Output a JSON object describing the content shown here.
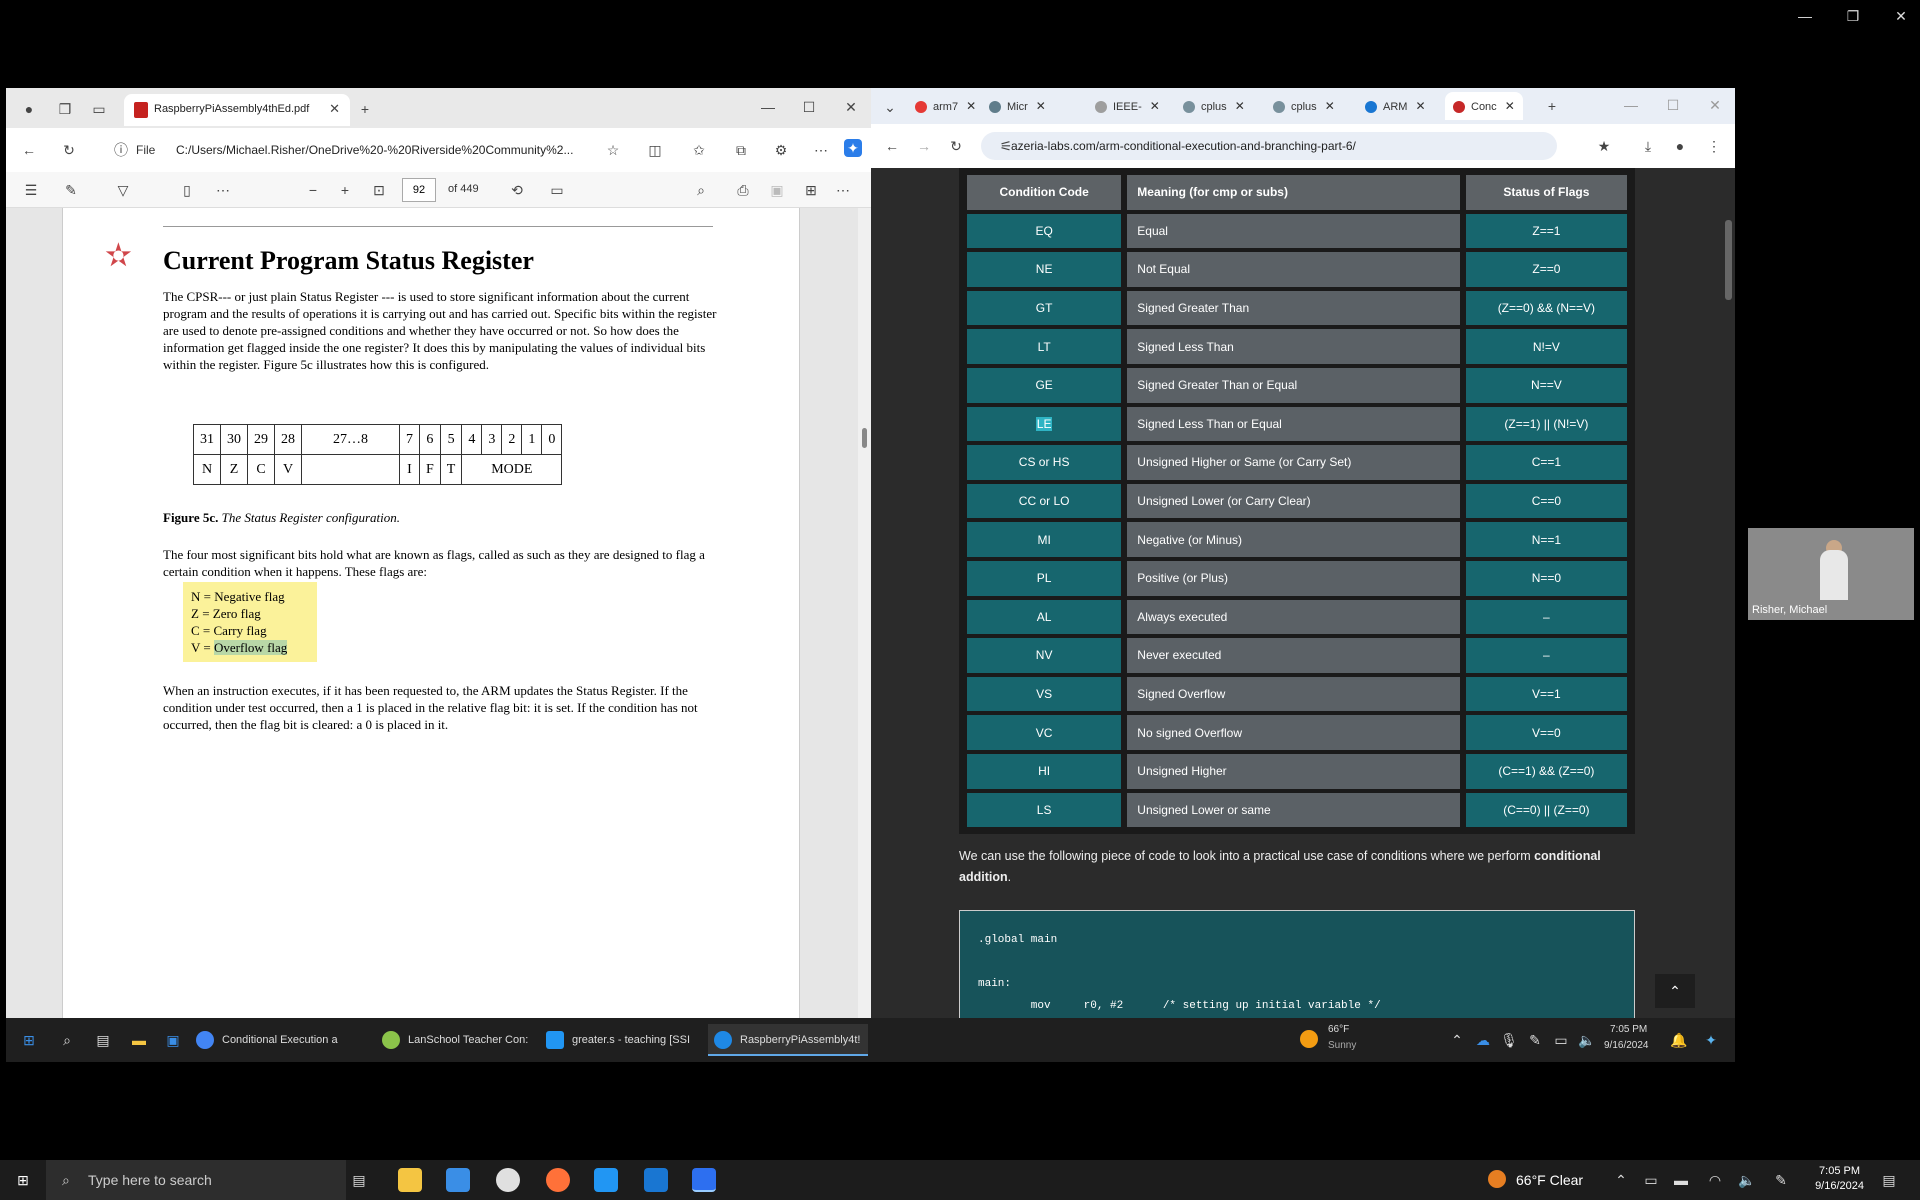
{
  "pdf": {
    "tab_title": "RaspberryPiAssembly4thEd.pdf",
    "url_label": "File",
    "url": "C:/Users/Michael.Risher/OneDrive%20-%20Riverside%20Community%2...",
    "page_number": "92",
    "page_of": "of 449",
    "title": "Current Program Status Register",
    "para1": "The CPSR--- or just plain Status Register --- is used to store significant information about the current program and the results of operations it is carrying out and has carried out. Specific bits within the register are used to denote pre-assigned conditions and whether they have occurred or not. So how does the information get flagged inside the one register? It does this by manipulating the values of individual bits within the register. Figure 5c illustrates how this is configured.",
    "reg_top": [
      "31",
      "30",
      "29",
      "28",
      "27…8",
      "7",
      "6",
      "5",
      "4",
      "3",
      "2",
      "1",
      "0"
    ],
    "reg_bottom": [
      "N",
      "Z",
      "C",
      "V",
      "",
      "I",
      "F",
      "T",
      "MODE"
    ],
    "fig_label": "Figure 5c.",
    "fig_caption": "The Status Register configuration.",
    "para2": "The four most significant bits hold what are known as flags, called as such as they are designed to flag a certain condition when it happens. These flags are:",
    "flags": [
      "N = Negative flag",
      "Z = Zero flag",
      "C = Carry flag"
    ],
    "flag_v_prefix": "V = ",
    "flag_v_highlight": "Overflow flag",
    "para3": "When an instruction executes, if it has been requested to, the ARM updates the Status Register. If the condition under test occurred, then a 1 is placed in the relative flag bit: it is set. If the condition has not occurred, then the flag bit is cleared: a 0 is placed in it."
  },
  "chrome": {
    "tabs": [
      {
        "label": "arm7",
        "color": "#e53935"
      },
      {
        "label": "Micr",
        "color": "#607d8b"
      },
      {
        "label": "IEEE-",
        "color": "#9e9e9e"
      },
      {
        "label": "cplus",
        "color": "#78909c"
      },
      {
        "label": "cplus",
        "color": "#78909c"
      },
      {
        "label": "ARM",
        "color": "#1976d2"
      },
      {
        "label": "Conc",
        "color": "#c62828"
      }
    ],
    "url": "azeria-labs.com/arm-conditional-execution-and-branching-part-6/",
    "table_headers": [
      "Condition Code",
      "Meaning (for cmp or subs)",
      "Status of Flags"
    ],
    "rows": [
      [
        "EQ",
        "Equal",
        "Z==1"
      ],
      [
        "NE",
        "Not Equal",
        "Z==0"
      ],
      [
        "GT",
        "Signed Greater Than",
        "(Z==0) && (N==V)"
      ],
      [
        "LT",
        "Signed Less Than",
        "N!=V"
      ],
      [
        "GE",
        "Signed Greater Than or Equal",
        "N==V"
      ],
      [
        "LE",
        "Signed Less Than or Equal",
        "(Z==1) || (N!=V)"
      ],
      [
        "CS or HS",
        "Unsigned Higher or Same (or Carry Set)",
        "C==1"
      ],
      [
        "CC or LO",
        "Unsigned Lower (or Carry Clear)",
        "C==0"
      ],
      [
        "MI",
        "Negative (or Minus)",
        "N==1"
      ],
      [
        "PL",
        "Positive (or Plus)",
        "N==0"
      ],
      [
        "AL",
        "Always executed",
        "–"
      ],
      [
        "NV",
        "Never executed",
        "–"
      ],
      [
        "VS",
        "Signed Overflow",
        "V==1"
      ],
      [
        "VC",
        "No signed Overflow",
        "V==0"
      ],
      [
        "HI",
        "Unsigned Higher",
        "(C==1) && (Z==0)"
      ],
      [
        "LS",
        "Unsigned Lower or same",
        "(C==0) || (Z==0)"
      ]
    ],
    "para_prefix": "We can use the following piece of code to look into a practical use case of conditions where we perform ",
    "para_bold": "conditional addition",
    "para_suffix": ".",
    "code": ".global main\n\nmain:\n        mov     r0, #2      /* setting up initial variable */"
  },
  "inner_taskbar": {
    "items": [
      {
        "label": "Conditional Execution a",
        "color": "#4285f4"
      },
      {
        "label": "LanSchool Teacher Con:",
        "color": "#8bc34a"
      },
      {
        "label": "greater.s - teaching [SSI",
        "color": "#2196f3"
      },
      {
        "label": "RaspberryPiAssembly4t!",
        "color": "#1e88e5"
      }
    ],
    "weather_temp": "66°F",
    "weather_desc": "Sunny",
    "time": "7:05 PM",
    "date": "9/16/2024"
  },
  "video": {
    "name": "Risher, Michael"
  },
  "host_taskbar": {
    "search_placeholder": "Type here to search",
    "weather": "66°F  Clear",
    "time": "7:05 PM",
    "date": "9/16/2024"
  }
}
